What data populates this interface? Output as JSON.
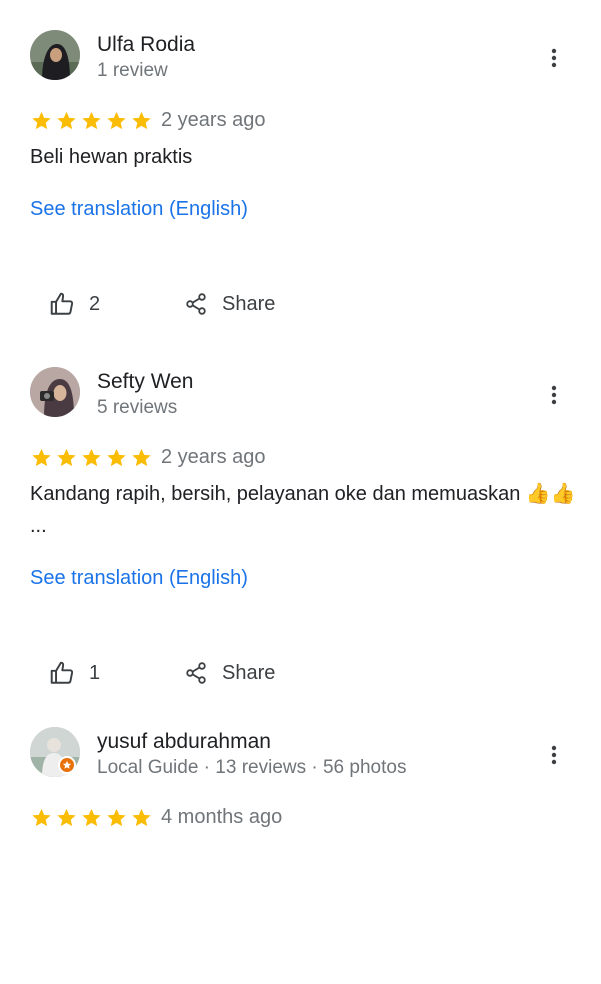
{
  "reviews": [
    {
      "name": "Ulfa Rodia",
      "meta": "1 review",
      "rating": 5,
      "date": "2 years ago",
      "text": "Beli hewan praktis",
      "translate_label": "See translation (English)",
      "likes": "2",
      "share_label": "Share"
    },
    {
      "name": "Sefty Wen",
      "meta": "5 reviews",
      "rating": 5,
      "date": "2 years ago",
      "text": "Kandang rapih, bersih, pelayanan oke dan memuaskan 👍👍 ...",
      "translate_label": "See translation (English)",
      "likes": "1",
      "share_label": "Share"
    },
    {
      "name": "yusuf abdurahman",
      "meta": "Local Guide · 13 reviews · 56 photos",
      "rating": 5,
      "date": "4 months ago"
    }
  ],
  "colors": {
    "star": "#fbbc04",
    "link": "#1a73e8",
    "secondary_text": "#70757a",
    "local_guide_badge": "#e8710a"
  },
  "icons": {
    "more": "more-vert-icon",
    "like": "thumb-up-icon",
    "share": "share-icon",
    "star": "star-icon"
  }
}
